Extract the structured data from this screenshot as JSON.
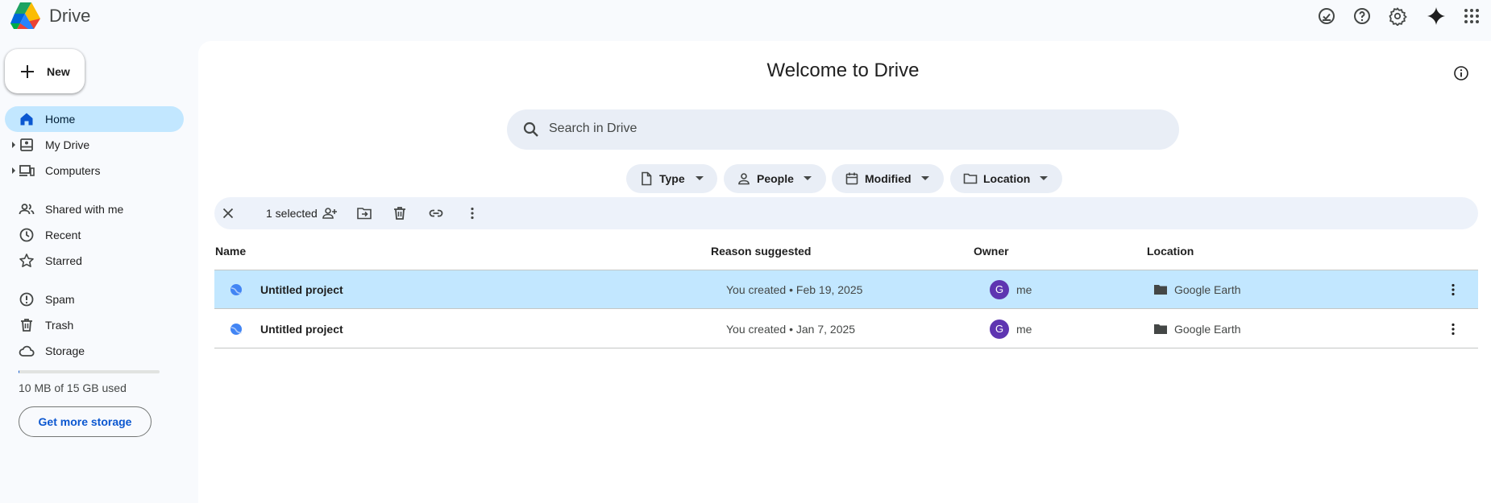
{
  "app": {
    "title": "Drive"
  },
  "header": {
    "icons": [
      "ready-for-offline-icon",
      "help-icon",
      "settings-icon",
      "gemini-icon",
      "apps-grid-icon"
    ]
  },
  "sidebar": {
    "new_label": "New",
    "items": [
      {
        "label": "Home",
        "active": true,
        "icon": "home-icon"
      },
      {
        "label": "My Drive",
        "icon": "my-drive-icon",
        "expandable": true
      },
      {
        "label": "Computers",
        "icon": "computers-icon",
        "expandable": true
      },
      {
        "label": "Shared with me",
        "icon": "shared-icon"
      },
      {
        "label": "Recent",
        "icon": "clock-icon"
      },
      {
        "label": "Starred",
        "icon": "star-icon"
      },
      {
        "label": "Spam",
        "icon": "spam-icon"
      },
      {
        "label": "Trash",
        "icon": "trash-icon"
      },
      {
        "label": "Storage",
        "icon": "cloud-icon"
      }
    ],
    "storage": {
      "text": "10 MB of 15 GB used",
      "used_fraction": 0.001,
      "button": "Get more storage"
    }
  },
  "main": {
    "welcome": "Welcome to Drive",
    "search": {
      "placeholder": "Search in Drive"
    },
    "filters": [
      "Type",
      "People",
      "Modified",
      "Location"
    ],
    "selection": {
      "count_text": "1 selected"
    },
    "columns": {
      "name": "Name",
      "reason": "Reason suggested",
      "owner": "Owner",
      "location": "Location"
    },
    "files": [
      {
        "name": "Untitled project",
        "reason": "You created • Feb 19, 2025",
        "owner_initial": "G",
        "owner": "me",
        "location": "Google Earth",
        "selected": true
      },
      {
        "name": "Untitled project",
        "reason": "You created • Jan 7, 2025",
        "owner_initial": "G",
        "owner": "me",
        "location": "Google Earth",
        "selected": false
      }
    ]
  },
  "colors": {
    "accent": "#0b57d0",
    "active_nav_bg": "#c2e7ff",
    "selected_row_bg": "#c2e7ff",
    "avatar_bg": "#5e35b1",
    "chip_bg": "#e9eef6"
  }
}
